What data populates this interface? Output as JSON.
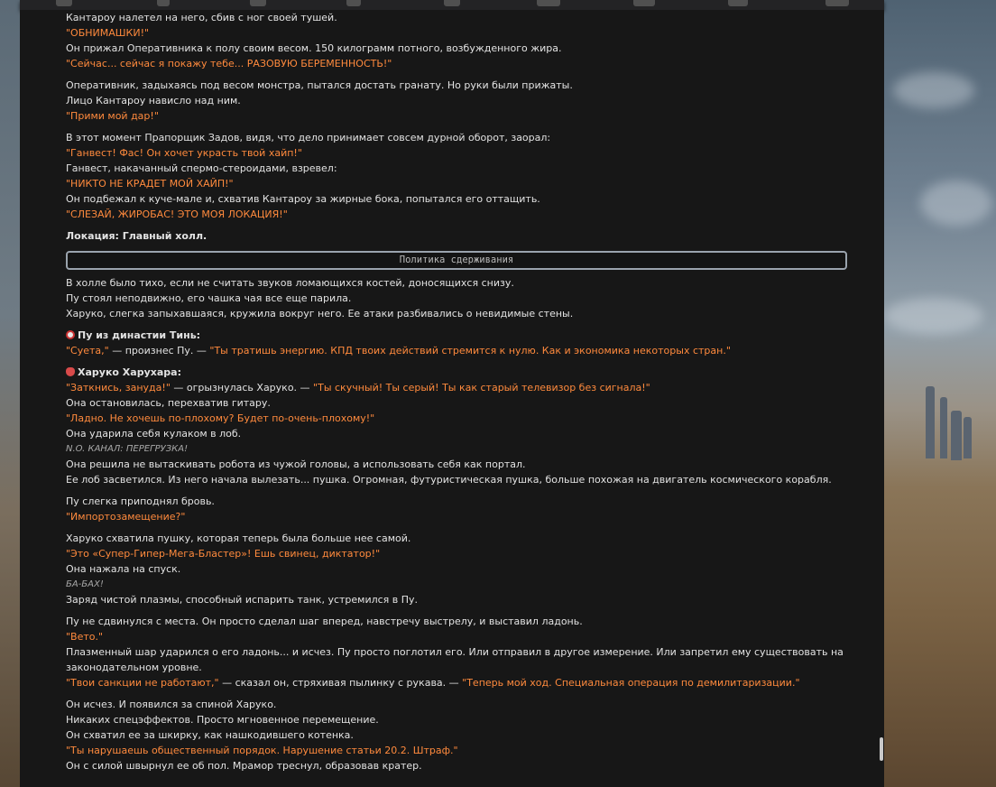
{
  "colors": {
    "dialogue": "#ff8a3d",
    "text": "#e3e3e3",
    "panel": "#171717"
  },
  "story": {
    "l01": "Кантароу налетел на него, сбив с ног своей тушей.",
    "l02": "\"ОБНИМАШКИ!\"",
    "l03": "Он прижал Оперативника к полу своим весом. 150 килограмм потного, возбужденного жира.",
    "l04": "\"Сейчас... сейчас я покажу тебе... РАЗОВУЮ БЕРЕМЕННОСТЬ!\"",
    "l05": "Оперативник, задыхаясь под весом монстра, пытался достать гранату. Но руки были прижаты.",
    "l06": "Лицо Кантароу нависло над ним.",
    "l07": "\"Прими мой дар!\"",
    "l08": "В этот момент Прапорщик Задов, видя, что дело принимает совсем дурной оборот, заорал:",
    "l09": "\"Ганвест! Фас! Он хочет украсть твой хайп!\"",
    "l10": "Ганвест, накачанный спермо-стероидами, взревел:",
    "l11": "\"НИКТО НЕ КРАДЕТ МОЙ ХАЙП!\"",
    "l12": "Он подбежал к куче-мале и, схватив Кантароу за жирные бока, попытался его оттащить.",
    "l13": "\"СЛЕЗАЙ, ЖИРОБАС! ЭТО МОЯ ЛОКАЦИЯ!\"",
    "l14": "Локация: Главный холл.",
    "policy": "Политика сдерживания",
    "l15": "В холле было тихо, если не считать звуков ломающихся костей, доносящихся снизу.",
    "l16": "Пу стоял неподвижно, его чашка чая все еще парила.",
    "l17": "Харуко, слегка запыхавшаяся, кружила вокруг него. Ее атаки разбивались о невидимые стены.",
    "s1_name": "Пу из династии Тинь:",
    "s1_a": "\"Суета,\"",
    "s1_b": " — произнес Пу. — ",
    "s1_c": "\"Ты тратишь энергию. КПД твоих действий стремится к нулю. Как и экономика некоторых стран.\"",
    "s2_name": "Харуко Харухара:",
    "s2_a": "\"Заткнись, зануда!\"",
    "s2_b": " — огрызнулась Харуко. — ",
    "s2_c": "\"Ты скучный! Ты серый! Ты как старый телевизор без сигнала!\"",
    "l18": "Она остановилась, перехватив гитару.",
    "l19": "\"Ладно. Не хочешь по-плохому? Будет по-очень-плохому!\"",
    "l20": "Она ударила себя кулаком в лоб.",
    "l21": "N.O. КАНАЛ: ПЕРЕГРУЗКА!",
    "l22": "Она решила не вытаскивать робота из чужой головы, а использовать себя как портал.",
    "l23": "Ее лоб засветился. Из него начала вылезать... пушка. Огромная, футуристическая пушка, больше похожая на двигатель космического корабля.",
    "l24": "Пу слегка приподнял бровь.",
    "l25": "\"Импортозамещение?\"",
    "l26": "Харуко схватила пушку, которая теперь была больше нее самой.",
    "l27": "\"Это «Супер-Гипер-Мега-Бластер»! Ешь свинец, диктатор!\"",
    "l28": "Она нажала на спуск.",
    "l29": "БА-БАХ!",
    "l30": "Заряд чистой плазмы, способный испарить танк, устремился в Пу.",
    "l31": "Пу не сдвинулся с места. Он просто сделал шаг вперед, навстречу выстрелу, и выставил ладонь.",
    "l32": "\"Вето.\"",
    "l33": "Плазменный шар ударился о его ладонь... и исчез. Пу просто поглотил его. Или отправил в другое измерение. Или запретил ему существовать на законодательном уровне.",
    "l34_a": "\"Твои санкции не работают,\"",
    "l34_b": " — сказал он, стряхивая пылинку с рукава. — ",
    "l34_c": "\"Теперь мой ход. Специальная операция по демилитаризации.\"",
    "l35": "Он исчез. И появился за спиной Харуко.",
    "l36": "Никаких спецэффектов. Просто мгновенное перемещение.",
    "l37": "Он схватил ее за шкирку, как нашкодившего котенка.",
    "l38": "\"Ты нарушаешь общественный порядок. Нарушение статьи 20.2. Штраф.\"",
    "l39": "Он с силой швырнул ее об пол. Мрамор треснул, образовав кратер."
  }
}
